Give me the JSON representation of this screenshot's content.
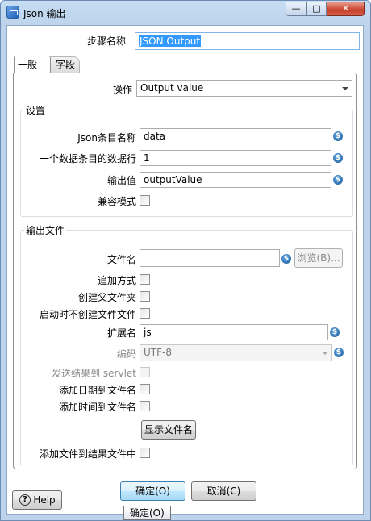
{
  "window": {
    "title": "Json 输出",
    "controls": {
      "minimize": "—",
      "maximize": "□",
      "close": "✕"
    }
  },
  "step_name": {
    "label": "步骤名称",
    "value": "JSON Output"
  },
  "tabs": [
    {
      "label": "一般",
      "selected": true
    },
    {
      "label": "字段",
      "selected": false
    }
  ],
  "general": {
    "operation": {
      "label": "操作",
      "value": "Output value"
    },
    "settings": {
      "title": "设置",
      "json_block_name": {
        "label": "Json条目名称",
        "value": "data"
      },
      "rows_per_block": {
        "label": "一个数据条目的数据行",
        "value": "1"
      },
      "output_value": {
        "label": "输出值",
        "value": "outputValue"
      },
      "compat_mode": {
        "label": "兼容模式",
        "checked": false
      }
    },
    "output_file": {
      "title": "输出文件",
      "filename": {
        "label": "文件名",
        "value": ""
      },
      "browse_label": "浏览(B)...",
      "append": {
        "label": "追加方式",
        "checked": false
      },
      "create_parent": {
        "label": "创建父文件夹",
        "checked": false
      },
      "no_create_on_start": {
        "label": "启动时不创建文件文件",
        "checked": false
      },
      "extension": {
        "label": "扩展名",
        "value": "js"
      },
      "encoding": {
        "label": "编码",
        "value": "UTF-8"
      },
      "send_to_servlet": {
        "label": "发送结果到 servlet",
        "checked": false
      },
      "add_date": {
        "label": "添加日期到文件名",
        "checked": false
      },
      "add_time": {
        "label": "添加时间到文件名",
        "checked": false
      },
      "show_filename_label": "显示文件名",
      "add_to_result": {
        "label": "添加文件到结果文件中",
        "checked": false
      }
    }
  },
  "footer": {
    "help_label": "Help",
    "ok_label": "确定(O)",
    "cancel_label": "取消(C)",
    "tooltip": "确定(O)"
  },
  "icons": {
    "variable": "variable-dollar-icon",
    "help": "help-question-icon",
    "app": "json-output-step-icon"
  }
}
